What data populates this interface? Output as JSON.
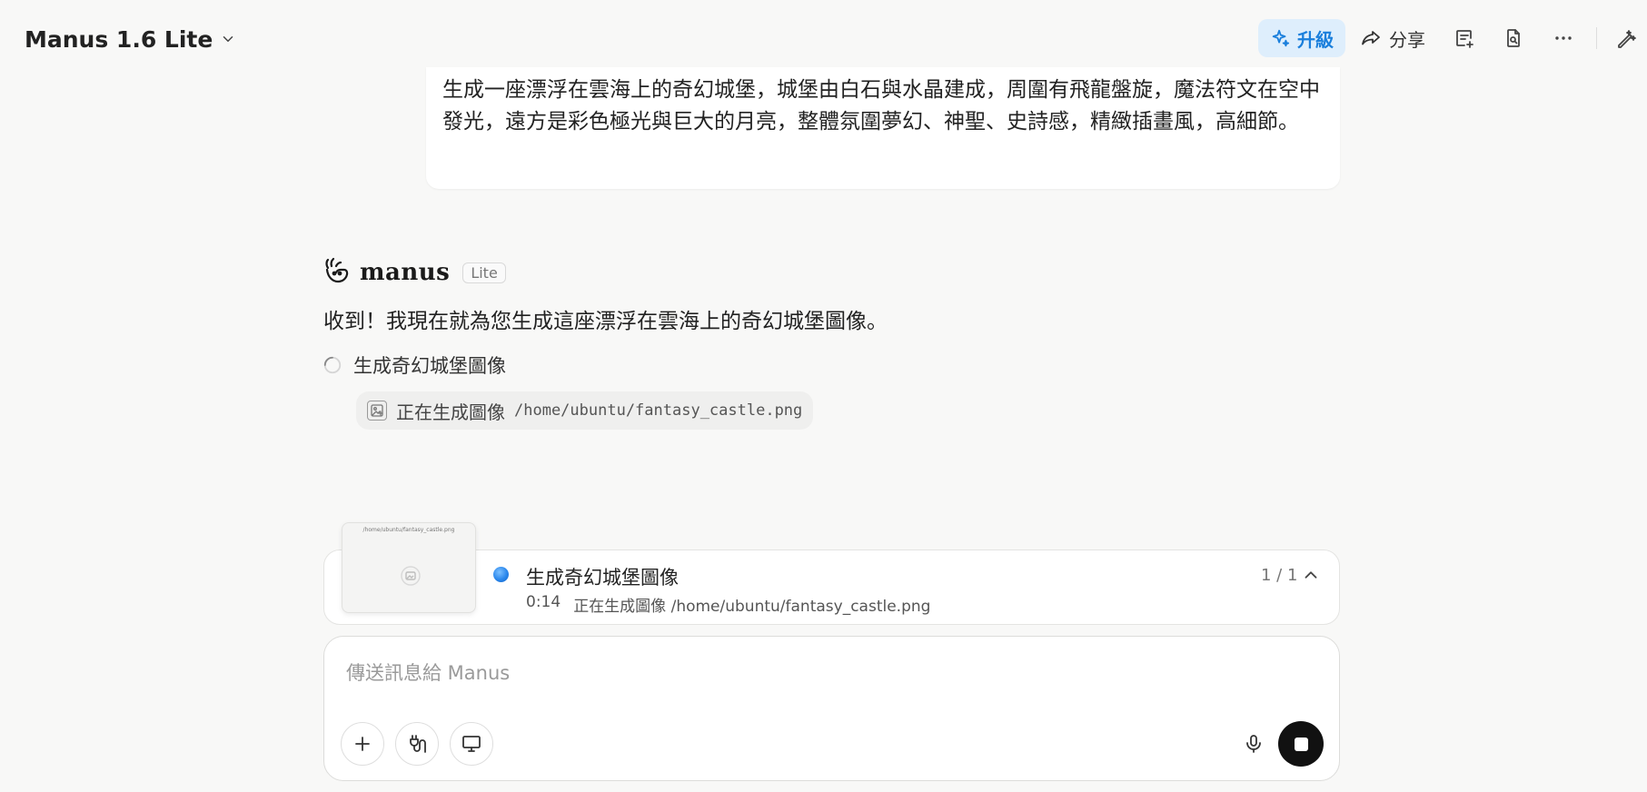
{
  "header": {
    "model_name": "Manus 1.6 Lite",
    "upgrade_label": "升級",
    "share_label": "分享"
  },
  "user_message": {
    "text": "生成一座漂浮在雲海上的奇幻城堡，城堡由白石與水晶建成，周圍有飛龍盤旋，魔法符文在空中發光，遠方是彩色極光與巨大的月亮，整體氛圍夢幻、神聖、史詩感，精緻插畫風，高細節。"
  },
  "assistant": {
    "brand": "manus",
    "badge": "Lite",
    "reply": "收到！我現在就為您生成這座漂浮在雲海上的奇幻城堡圖像。",
    "step_label": "生成奇幻城堡圖像",
    "tool_action": "正在生成圖像",
    "tool_path": "/home/ubuntu/fantasy_castle.png"
  },
  "task_card": {
    "thumb_path": "/home/ubuntu/fantasy_castle.png",
    "title": "生成奇幻城堡圖像",
    "elapsed": "0:14",
    "status": "正在生成圖像 /home/ubuntu/fantasy_castle.png",
    "count": "1 / 1"
  },
  "composer": {
    "placeholder": "傳送訊息給 Manus"
  },
  "colors": {
    "accent": "#1a7fdc",
    "upgrade_bg": "#deeefc",
    "background": "#f8f8f7"
  }
}
